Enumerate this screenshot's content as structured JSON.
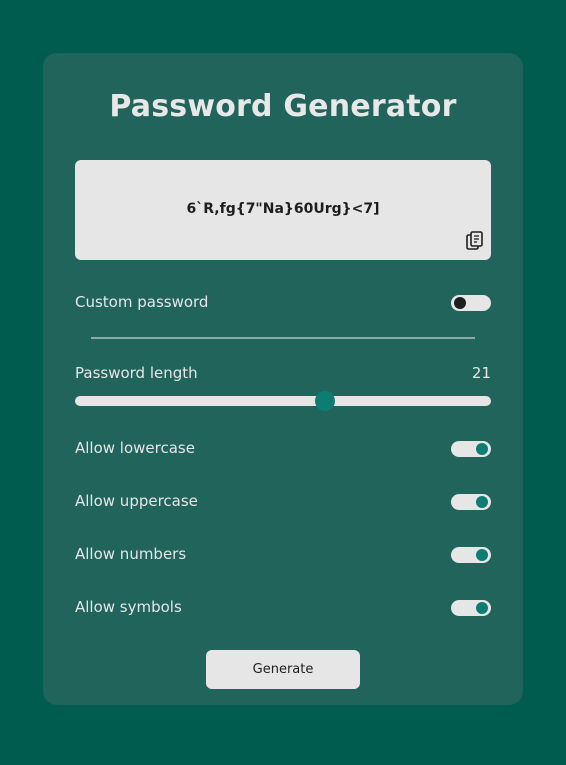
{
  "title": "Password Generator",
  "password": "6`R,fg{7\"Na}60Urg}<7]",
  "copy": {
    "icon": "clipboard-copy-icon"
  },
  "custom_password": {
    "label": "Custom password",
    "enabled": false
  },
  "length": {
    "label": "Password length",
    "value": "21",
    "min": 1,
    "max": 35,
    "slider_fraction": 0.6
  },
  "options": [
    {
      "label": "Allow lowercase",
      "enabled": true
    },
    {
      "label": "Allow uppercase",
      "enabled": true
    },
    {
      "label": "Allow numbers",
      "enabled": true
    },
    {
      "label": "Allow symbols",
      "enabled": true
    }
  ],
  "generate_label": "Generate",
  "colors": {
    "background": "#005c4f",
    "card": "#20645b",
    "accent": "#0f7c74",
    "surface": "#e6e6e6",
    "text_dark": "#1e1e1e"
  }
}
